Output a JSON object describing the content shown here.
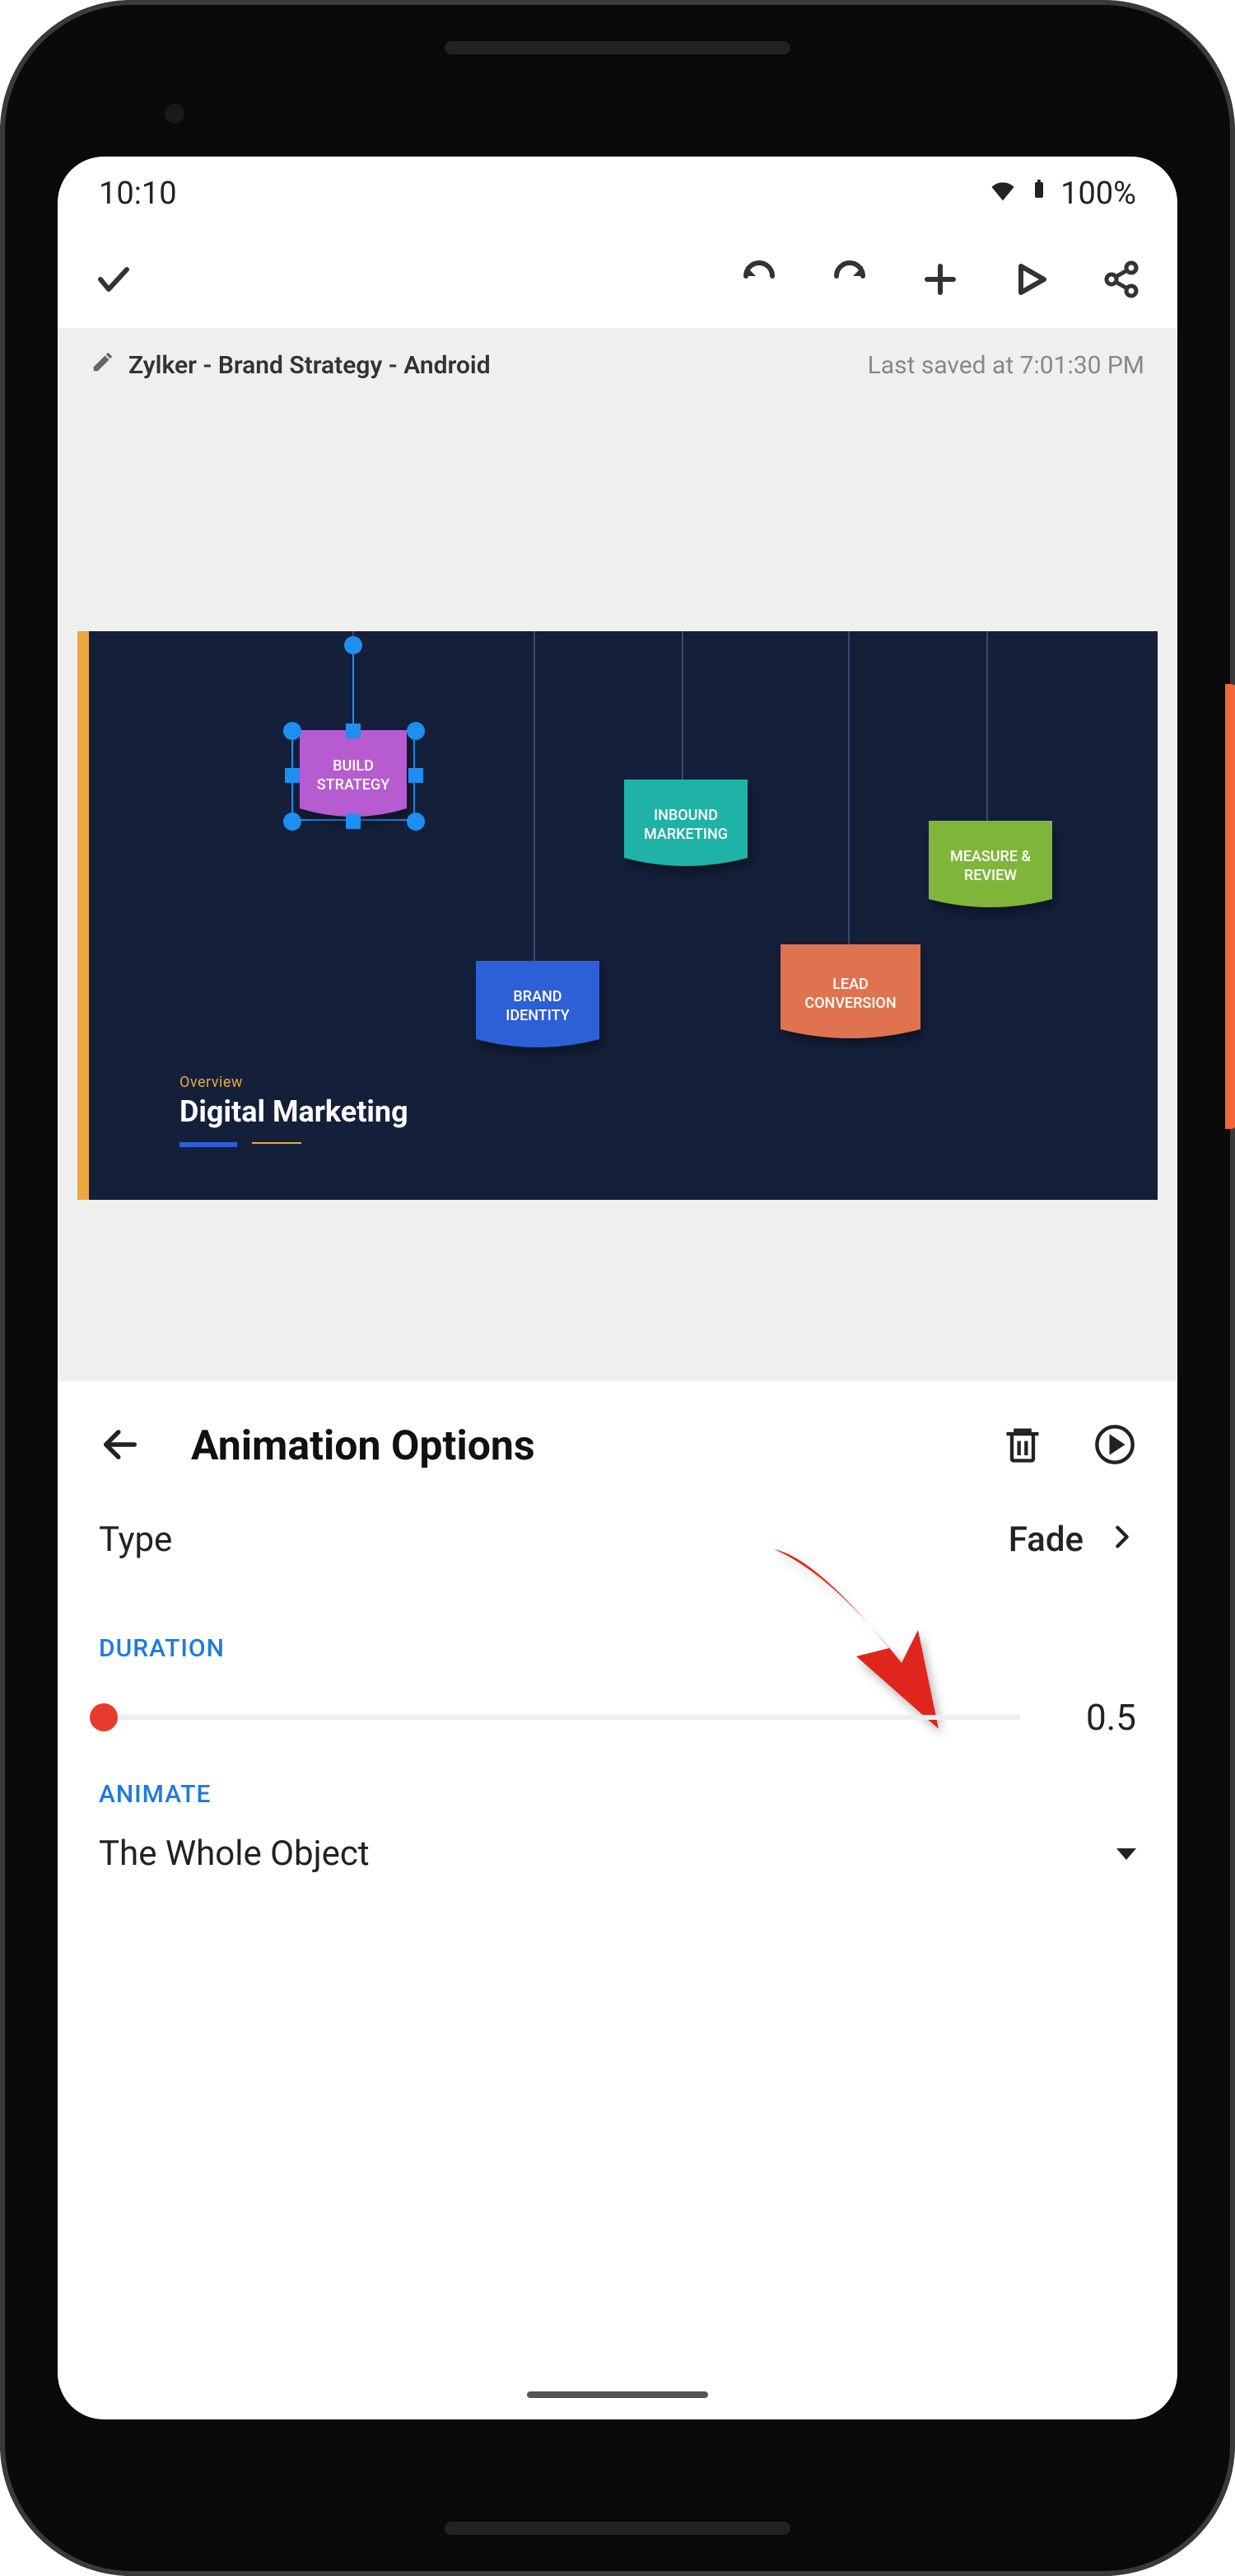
{
  "status": {
    "time": "10:10",
    "battery": "100%"
  },
  "doc": {
    "title": "Zylker - Brand Strategy - Android",
    "saved": "Last saved at 7:01:30 PM"
  },
  "slide": {
    "overview": "Overview",
    "title": "Digital Marketing",
    "banners": [
      {
        "label": "BUILD\nSTRATEGY",
        "color": "#b65bd0",
        "selected": true
      },
      {
        "label": "INBOUND\nMARKETING",
        "color": "#1fb2a6",
        "selected": false
      },
      {
        "label": "MEASURE &\nREVIEW",
        "color": "#7fb63a",
        "selected": false
      },
      {
        "label": "BRAND\nIDENTITY",
        "color": "#2d5fd6",
        "selected": false
      },
      {
        "label": "LEAD\nCONVERSION",
        "color": "#e0734f",
        "selected": false
      }
    ]
  },
  "panel": {
    "title": "Animation Options",
    "type_label": "Type",
    "type_value": "Fade",
    "duration_label": "DURATION",
    "duration_value": "0.5",
    "animate_label": "ANIMATE",
    "animate_value": "The Whole Object"
  },
  "icons": {
    "confirm": "check-icon",
    "undo": "undo-icon",
    "redo": "redo-icon",
    "add": "plus-icon",
    "play": "play-icon",
    "share": "share-icon",
    "edit": "pencil-icon",
    "back": "arrow-left-icon",
    "delete": "trash-icon",
    "preview": "play-circle-icon",
    "wifi": "wifi-icon",
    "battery": "battery-icon",
    "chevron": "chevron-right-icon",
    "caret": "caret-down-icon"
  },
  "annotation": {
    "arrow_color": "#e0261c"
  }
}
